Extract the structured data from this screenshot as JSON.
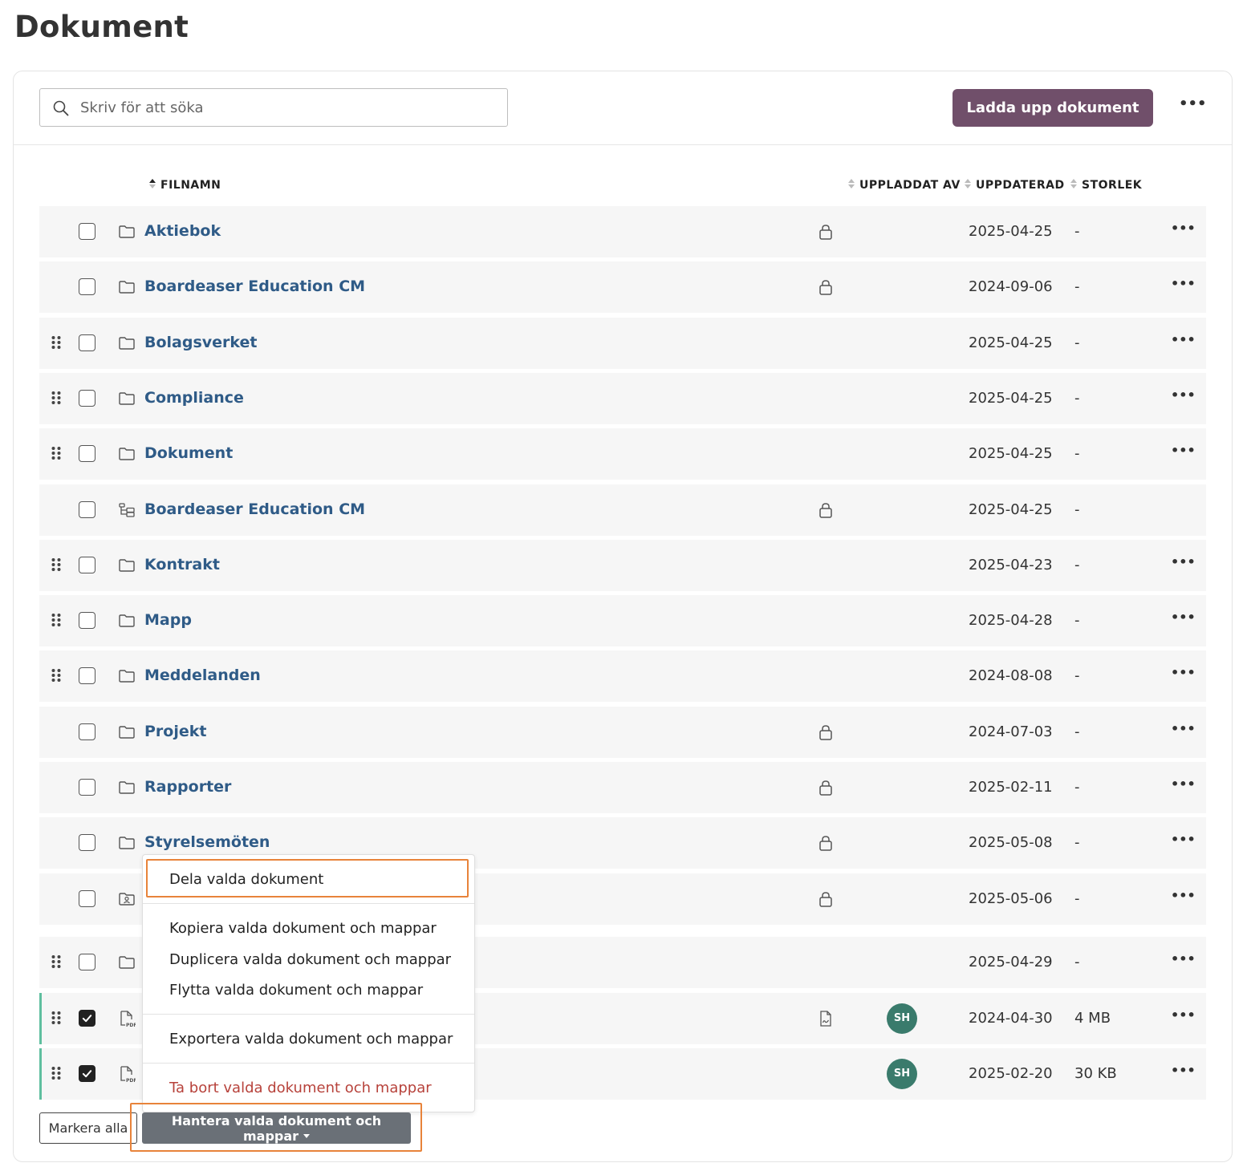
{
  "page": {
    "title": "Dokument"
  },
  "toolbar": {
    "search_placeholder": "Skriv för att söka",
    "search_value": "",
    "upload_label": "Ladda upp dokument",
    "more_label": "•••"
  },
  "table": {
    "headers": {
      "filename": "FILNAMN",
      "uploaded_by": "UPPLADDAT AV",
      "updated": "UPPDATERAD",
      "size": "STORLEK"
    },
    "rows": [
      {
        "name": "Aktiebok",
        "icon": "folder-icon",
        "draggable": false,
        "locked": true,
        "uploader": "",
        "date": "2025-04-25",
        "size": "-",
        "checked": false,
        "more": "•••"
      },
      {
        "name": "Boardeaser Education CM",
        "icon": "folder-icon",
        "draggable": false,
        "locked": true,
        "uploader": "",
        "date": "2024-09-06",
        "size": "-",
        "checked": false,
        "more": "•••"
      },
      {
        "name": "Bolagsverket",
        "icon": "folder-icon",
        "draggable": true,
        "locked": false,
        "uploader": "",
        "date": "2025-04-25",
        "size": "-",
        "checked": false,
        "more": "•••"
      },
      {
        "name": "Compliance",
        "icon": "folder-icon",
        "draggable": true,
        "locked": false,
        "uploader": "",
        "date": "2025-04-25",
        "size": "-",
        "checked": false,
        "more": "•••"
      },
      {
        "name": "Dokument",
        "icon": "folder-icon",
        "draggable": true,
        "locked": false,
        "uploader": "",
        "date": "2025-04-25",
        "size": "-",
        "checked": false,
        "more": "•••"
      },
      {
        "name": "Boardeaser Education CM",
        "icon": "folder-tree-icon",
        "draggable": false,
        "locked": true,
        "uploader": "",
        "date": "2025-04-25",
        "size": "-",
        "checked": false,
        "more": ""
      },
      {
        "name": "Kontrakt",
        "icon": "folder-icon",
        "draggable": true,
        "locked": false,
        "uploader": "",
        "date": "2025-04-23",
        "size": "-",
        "checked": false,
        "more": "•••"
      },
      {
        "name": "Mapp",
        "icon": "folder-icon",
        "draggable": true,
        "locked": false,
        "uploader": "",
        "date": "2025-04-28",
        "size": "-",
        "checked": false,
        "more": "•••"
      },
      {
        "name": "Meddelanden",
        "icon": "folder-icon",
        "draggable": true,
        "locked": false,
        "uploader": "",
        "date": "2024-08-08",
        "size": "-",
        "checked": false,
        "more": "•••"
      },
      {
        "name": "Projekt",
        "icon": "folder-icon",
        "draggable": false,
        "locked": true,
        "uploader": "",
        "date": "2024-07-03",
        "size": "-",
        "checked": false,
        "more": "•••"
      },
      {
        "name": "Rapporter",
        "icon": "folder-icon",
        "draggable": false,
        "locked": true,
        "uploader": "",
        "date": "2025-02-11",
        "size": "-",
        "checked": false,
        "more": "•••"
      },
      {
        "name": "Styrelsemöten",
        "icon": "folder-icon",
        "draggable": false,
        "locked": true,
        "uploader": "",
        "date": "2025-05-08",
        "size": "-",
        "checked": false,
        "more": "•••"
      },
      {
        "name": "",
        "icon": "folder-person-icon",
        "draggable": false,
        "locked": true,
        "uploader": "",
        "date": "2025-05-06",
        "size": "-",
        "checked": false,
        "more": "•••"
      },
      {
        "name": "",
        "icon": "folder-icon",
        "draggable": true,
        "locked": false,
        "uploader": "",
        "date": "2025-04-29",
        "size": "-",
        "checked": false,
        "more": "•••"
      },
      {
        "name": "",
        "icon": "pdf-file-icon",
        "draggable": true,
        "locked": false,
        "signed": true,
        "uploader": "SH",
        "date": "2024-04-30",
        "size": "4 MB",
        "checked": true,
        "more": "•••"
      },
      {
        "name": "",
        "icon": "pdf-file-icon",
        "draggable": true,
        "locked": false,
        "uploader": "SH",
        "date": "2025-02-20",
        "size": "30 KB",
        "checked": true,
        "more": "•••"
      }
    ]
  },
  "dropdown": {
    "share": "Dela valda dokument",
    "copy": "Kopiera valda dokument och mappar",
    "duplicate": "Duplicera valda dokument och mappar",
    "move": "Flytta valda dokument och mappar",
    "export": "Exportera valda dokument och mappar",
    "delete": "Ta bort valda dokument och mappar"
  },
  "footer": {
    "select_all": "Markera alla",
    "manage": "Hantera valda dokument och mappar"
  },
  "colors": {
    "primary": "#704f6a",
    "link": "#2f5b87",
    "avatar": "#3a7b6c",
    "danger": "#b7423b",
    "highlight": "#e8833a",
    "selected_bar": "#5fbf9f",
    "manage_button": "#6a7077"
  }
}
